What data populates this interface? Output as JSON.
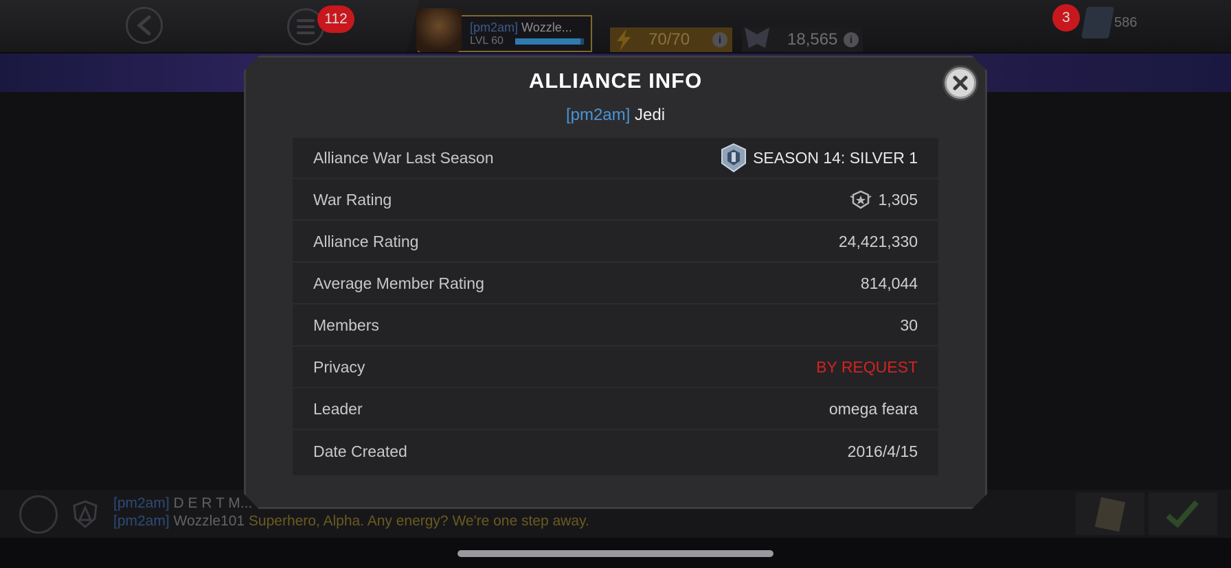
{
  "hud": {
    "notification_count": "112",
    "player_tag": "[pm2am]",
    "player_name": "Wozzle...",
    "player_level": "LVL 60",
    "xp_fraction": 0.95,
    "energy": "70/70",
    "gold": "18,565",
    "alert_count": "3",
    "units": "586"
  },
  "modal": {
    "title": "ALLIANCE INFO",
    "alliance_tag": "[pm2am]",
    "alliance_name": "Jedi",
    "rows": [
      {
        "label": "Alliance War Last Season",
        "value": "SEASON 14: SILVER 1"
      },
      {
        "label": "War Rating",
        "value": "1,305"
      },
      {
        "label": "Alliance Rating",
        "value": "24,421,330"
      },
      {
        "label": "Average Member Rating",
        "value": "814,044"
      },
      {
        "label": "Members",
        "value": "30"
      },
      {
        "label": "Privacy",
        "value": "BY REQUEST"
      },
      {
        "label": "Leader",
        "value": "omega feara"
      },
      {
        "label": "Date Created",
        "value": "2016/4/15"
      }
    ]
  },
  "chat": {
    "line1": {
      "tag": "[pm2am]",
      "name": "D E R T M...",
      "message": ""
    },
    "line2": {
      "tag": "[pm2am]",
      "name": "Wozzle101",
      "message": "Superhero, Alpha. Any energy? We're one step away."
    }
  },
  "colors": {
    "accent_blue": "#4c94d8",
    "privacy_red": "#d4231f",
    "modal_bg": "#2c2c2e"
  }
}
